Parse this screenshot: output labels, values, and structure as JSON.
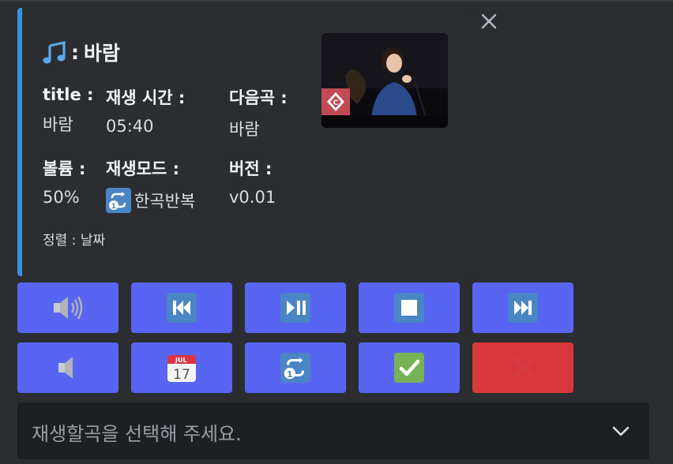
{
  "embed": {
    "title": "바람",
    "accent_color": "#3b8ee0",
    "title_icon": "musical-notes-icon",
    "fields": {
      "title": {
        "name": "title :",
        "value": "바람"
      },
      "duration": {
        "name": "재생 시간 :",
        "value": "05:40"
      },
      "next": {
        "name": "다음곡 :",
        "value": "바람"
      },
      "volume": {
        "name": "볼륨 :",
        "value": "50%"
      },
      "mode": {
        "name": "재생모드 :",
        "value": "한곡반복",
        "icon": "repeat-one-icon"
      },
      "version": {
        "name": "버전 :",
        "value": "v0.01"
      }
    },
    "footer": "정렬 : 날짜",
    "thumbnail": "singer-performance-thumbnail"
  },
  "buttons": {
    "row1": [
      {
        "icon": "speaker-loud-icon"
      },
      {
        "icon": "previous-track-icon"
      },
      {
        "icon": "play-pause-icon"
      },
      {
        "icon": "stop-icon"
      },
      {
        "icon": "next-track-icon"
      }
    ],
    "row2": [
      {
        "icon": "speaker-quiet-icon"
      },
      {
        "icon": "calendar-icon",
        "month": "JUL",
        "day": "17"
      },
      {
        "icon": "repeat-one-icon"
      },
      {
        "icon": "checkmark-icon"
      },
      {
        "icon": "cross-icon"
      }
    ],
    "primary_color": "#5865f2",
    "danger_color": "#da373c"
  },
  "select_menu": {
    "placeholder": "재생할곡을 선택해 주세요."
  }
}
